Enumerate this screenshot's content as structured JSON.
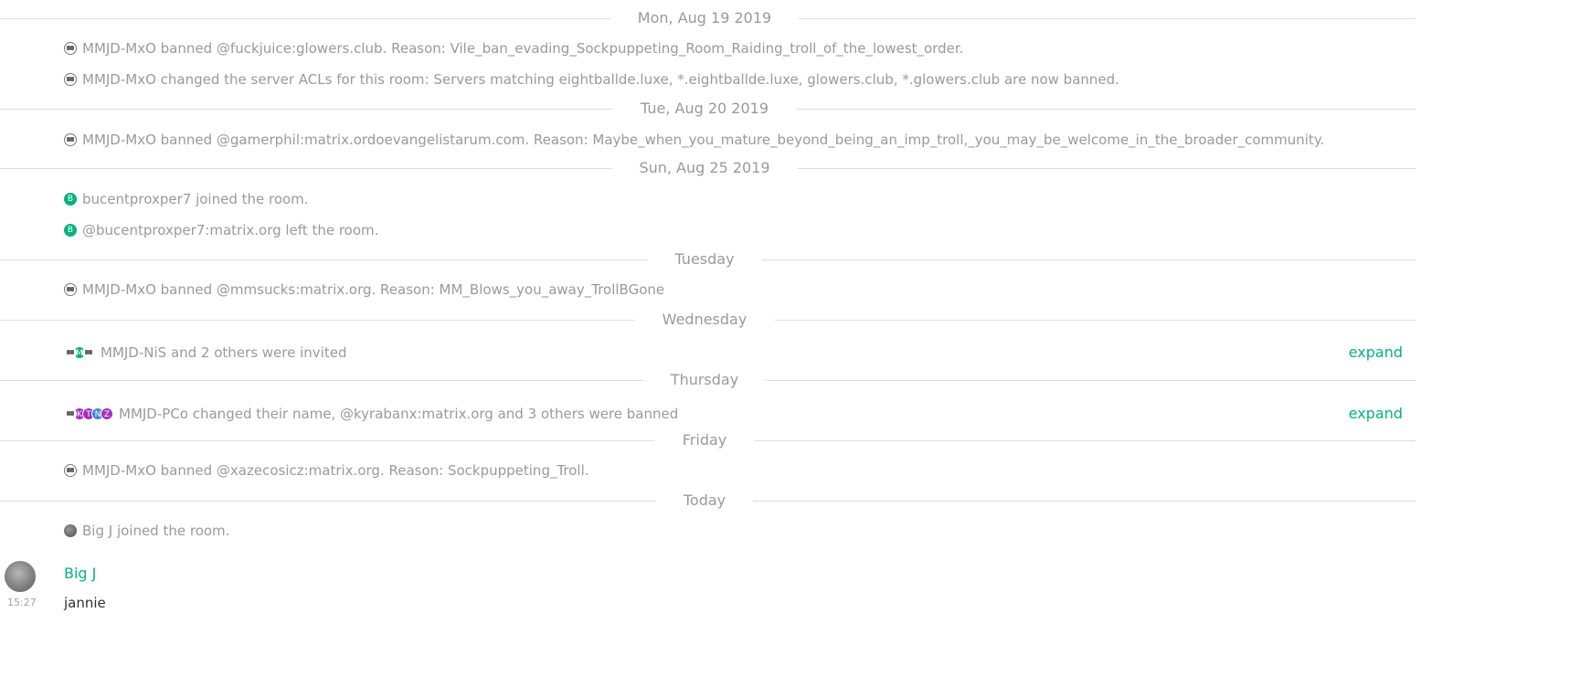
{
  "dates": {
    "d1": "Mon, Aug 19 2019",
    "d2": "Tue, Aug 20 2019",
    "d3": "Sun, Aug 25 2019",
    "d4": "Tuesday",
    "d5": "Wednesday",
    "d6": "Thursday",
    "d7": "Friday",
    "d8": "Today"
  },
  "events": {
    "e1": "MMJD-MxO banned @fuckjuice:glowers.club. Reason: Vile_ban_evading_Sockpuppeting_Room_Raiding_troll_of_the_lowest_order.",
    "e2": "MMJD-MxO changed the server ACLs for this room: Servers matching eightballde.luxe, *.eightballde.luxe, glowers.club, *.glowers.club are now banned.",
    "e3": "MMJD-MxO banned @gamerphil:matrix.ordoevangelistarum.com. Reason: Maybe_when_you_mature_beyond_being_an_imp_troll,_you_may_be_welcome_in_the_broader_community.",
    "e4": "bucentproxper7 joined the room.",
    "e5": "@bucentproxper7:matrix.org left the room.",
    "e6": "MMJD-MxO banned @mmsucks:matrix.org. Reason: MM_Blows_you_away_TrollBGone",
    "e7": "MMJD-NiS and 2 others were invited",
    "e8": "MMJD-PCo changed their name, @kyrabanx:matrix.org and 3 others were banned",
    "e9": "MMJD-MxO banned @xazecosicz:matrix.org. Reason: Sockpuppeting_Troll.",
    "e10": "Big J joined the room."
  },
  "avatar_letters": {
    "b": "B",
    "m": "M",
    "k": "K",
    "t": "T",
    "n": "N",
    "z": "Z"
  },
  "colors": {
    "green": "#03b381",
    "purple": "#a52fbf",
    "blue": "#368bd6"
  },
  "expand_label": "expand",
  "message": {
    "sender": "Big J",
    "time": "15:27",
    "body": "jannie"
  }
}
